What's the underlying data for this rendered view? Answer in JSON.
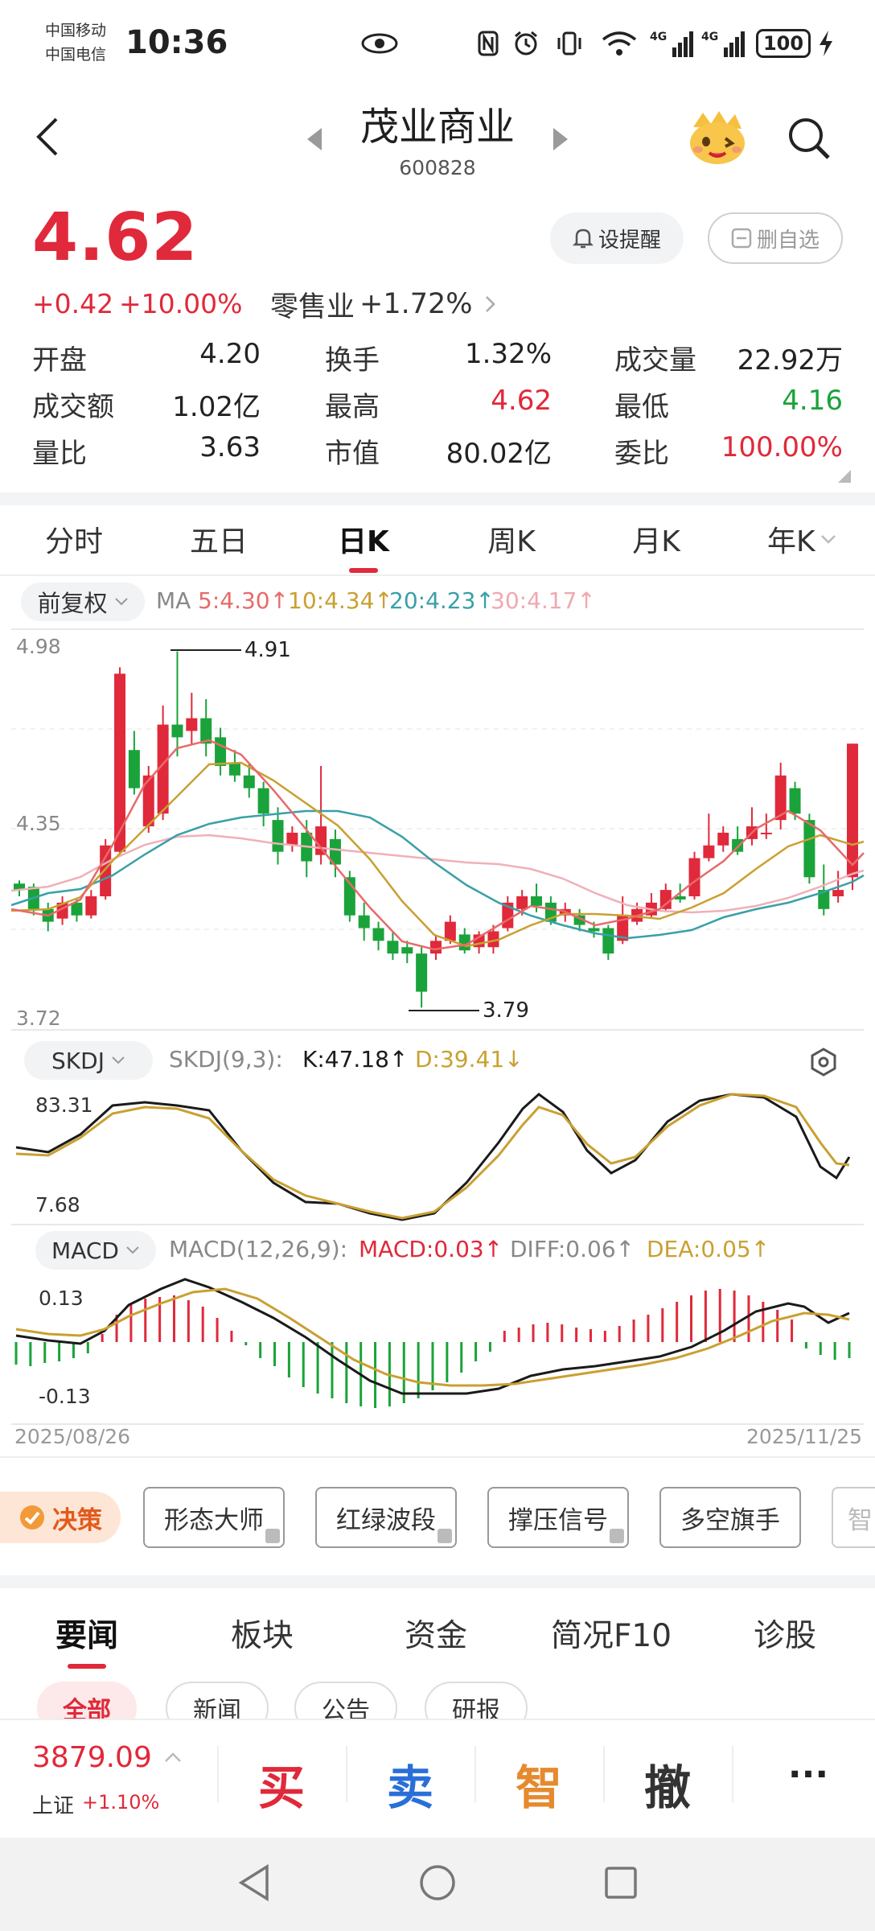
{
  "status_bar": {
    "carrier1": "中国移动",
    "carrier2": "中国电信",
    "time": "10:36",
    "net1": "4G",
    "net2": "4G",
    "battery": "100"
  },
  "header": {
    "title": "茂业商业",
    "code": "600828"
  },
  "quote": {
    "price": "4.62",
    "change": "+0.42",
    "change_pct": "+10.00%",
    "sector": "零售业",
    "sector_pct": "+1.72%",
    "remind_label": "设提醒",
    "unfav_label": "删自选",
    "stats": [
      {
        "label": "开盘",
        "value": "4.20"
      },
      {
        "label": "换手",
        "value": "1.32%"
      },
      {
        "label": "成交量",
        "value": "22.92万"
      },
      {
        "label": "成交额",
        "value": "1.02亿"
      },
      {
        "label": "最高",
        "value": "4.62"
      },
      {
        "label": "最低",
        "value": "4.16"
      },
      {
        "label": "量比",
        "value": "3.63"
      },
      {
        "label": "市值",
        "value": "80.02亿"
      },
      {
        "label": "委比",
        "value": "100.00%"
      }
    ]
  },
  "period_tabs": [
    "分时",
    "五日",
    "日K",
    "周K",
    "月K",
    "年K"
  ],
  "kline": {
    "adjust_label": "前复权",
    "ma_label": "MA",
    "ma5": "5:4.30↑",
    "ma10": "10:4.34↑",
    "ma20": "20:4.23↑",
    "ma30": "30:4.17↑",
    "y_top": "4.98",
    "y_mid": "4.35",
    "y_bot": "3.72",
    "high_mark": "4.91",
    "low_mark": "3.79",
    "colors": {
      "up": "#e0293a",
      "down": "#1aa33a",
      "ma5": "#e86a6a",
      "ma10": "#c9a032",
      "ma20": "#39a0a8",
      "ma30": "#f0b0b8"
    }
  },
  "skdj": {
    "selector": "SKDJ",
    "params": "SKDJ(9,3):",
    "k": "K:47.18↑",
    "d": "D:39.41↓",
    "y_top": "83.31",
    "y_bot": "7.68"
  },
  "macd": {
    "selector": "MACD",
    "params": "MACD(12,26,9):",
    "macd": "MACD:0.03↑",
    "diff": "DIFF:0.06↑",
    "dea": "DEA:0.05↑",
    "y_top": "0.13",
    "y_bot": "-0.13",
    "date_start": "2025/08/26",
    "date_end": "2025/11/25"
  },
  "tools": {
    "decision": "决策",
    "buttons": [
      "形态大师",
      "红绿波段",
      "撑压信号",
      "多空旗手",
      "智"
    ]
  },
  "news_tabs": [
    "要闻",
    "板块",
    "资金",
    "简况F10",
    "诊股"
  ],
  "news_chips": [
    "全部",
    "新闻",
    "公告",
    "研报"
  ],
  "bottom": {
    "index_value": "3879.09",
    "index_name": "上证",
    "index_pct": "+1.10%",
    "buy": "买",
    "sell": "卖",
    "smart": "智",
    "cancel": "撤",
    "more": "···"
  }
}
